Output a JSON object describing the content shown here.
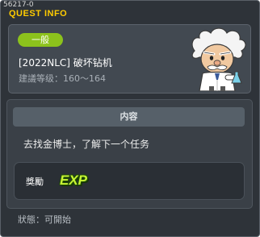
{
  "window": {
    "id_text": "56217-0",
    "title": "QUEST INFO"
  },
  "header": {
    "category": "一般",
    "quest_title": "[2022NLC] 破坏钻机",
    "level_range": "建議等级：160～164",
    "npc_icon": "scientist-npc-icon"
  },
  "content": {
    "header": "内容",
    "description": "去找金博士，了解下一个任务"
  },
  "reward": {
    "label": "獎勵",
    "icon_text": "EXP"
  },
  "status": {
    "text": "狀態：可開始"
  },
  "colors": {
    "title": "#ffcc00",
    "badge": "#8cc21c",
    "exp": "#c8f534"
  }
}
